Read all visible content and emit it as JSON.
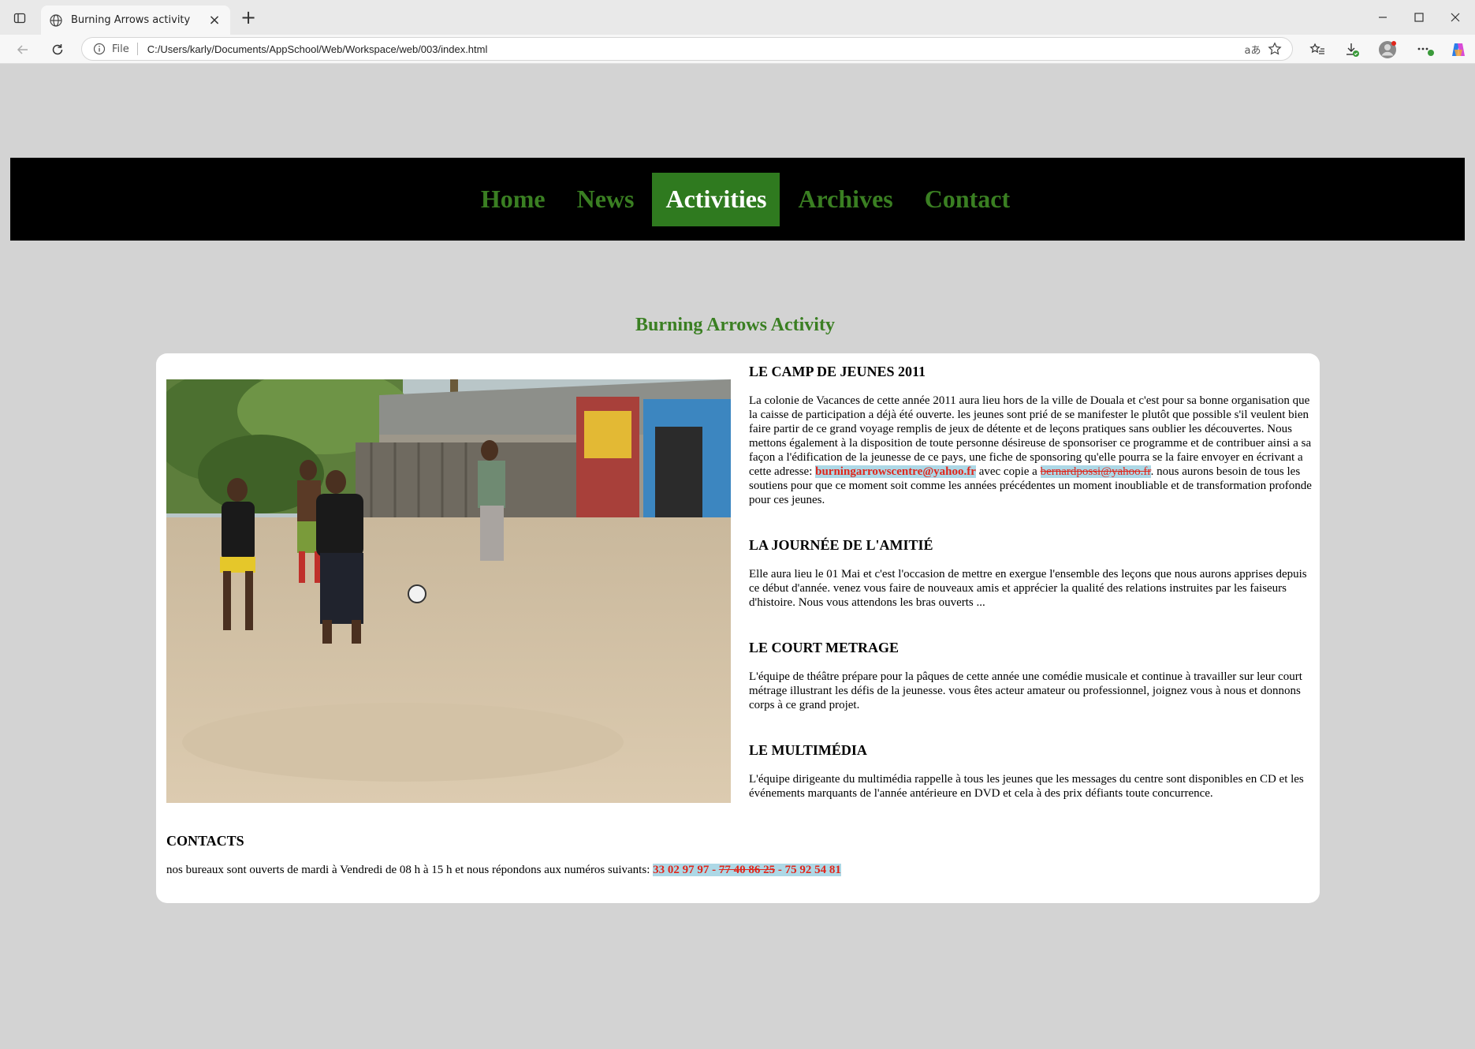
{
  "browser": {
    "tab_title": "Burning Arrows activity",
    "address_protocol": "File",
    "address_url": "C:/Users/karly/Documents/AppSchool/Web/Workspace/web/003/index.html",
    "read_aloud_label": "aあ"
  },
  "nav": {
    "items": [
      {
        "label": "Home",
        "active": false
      },
      {
        "label": "News",
        "active": false
      },
      {
        "label": "Activities",
        "active": true
      },
      {
        "label": "Archives",
        "active": false
      },
      {
        "label": "Contact",
        "active": false
      }
    ]
  },
  "page": {
    "title": "Burning Arrows Activity"
  },
  "sections": [
    {
      "heading": "LE CAMP DE JEUNES 2011",
      "text_before": "La colonie de Vacances de cette année 2011 aura lieu hors de la ville de Douala et c'est pour sa bonne organisation que la caisse de participation a déjà été ouverte. les jeunes sont prié de se manifester le plutôt que possible s'il veulent bien faire partir de ce grand voyage remplis de jeux de détente et de leçons pratiques sans oublier les découvertes. Nous mettons également à la disposition de toute personne désireuse de sponsoriser ce programme et de contribuer ainsi a sa façon a l'édification de la jeunesse de ce pays, une fiche de sponsoring qu'elle pourra se la faire envoyer en écrivant a cette adresse: ",
      "email_1": "burningarrowscentre@yahoo.fr",
      "text_middle": " avec copie a ",
      "email_2": "bernardpossi@yahoo.fr",
      "text_after": ". nous aurons besoin de tous les soutiens pour que ce moment soit comme les années précédentes un moment inoubliable et de transformation profonde pour ces jeunes."
    },
    {
      "heading": "LA JOURNÉE DE L'AMITIÉ",
      "text": "Elle aura lieu le 01 Mai et c'est l'occasion de mettre en exergue l'ensemble des leçons que nous aurons apprises depuis ce début d'année. venez vous faire de nouveaux amis et apprécier la qualité des relations instruites par les faiseurs d'histoire. Nous vous attendons les bras ouverts ..."
    },
    {
      "heading": "LE COURT METRAGE",
      "text": "L'équipe de théâtre prépare pour la pâques de cette année une comédie musicale et continue à travailler sur leur court métrage illustrant les défis de la jeunesse. vous êtes acteur amateur ou professionnel, joignez vous à nous et donnons corps à ce grand projet."
    },
    {
      "heading": "LE MULTIMÉDIA",
      "text": "L'équipe dirigeante du multimédia rappelle à tous les jeunes que les messages du centre sont disponibles en CD et les événements marquants de l'année antérieure en DVD et cela à des prix défiants toute concurrence."
    }
  ],
  "contacts": {
    "heading": "CONTACTS",
    "text": "nos bureaux sont ouverts de mardi à Vendredi de 08 h à 15 h et nous répondons aux numéros suivants: ",
    "phone_1": "33 02 97 97",
    "sep_1": " - ",
    "phone_2": "77 40 86 25",
    "sep_2": " - ",
    "phone_3": "75 92 54 81"
  },
  "colors": {
    "page_background": "#d3d3d3",
    "nav_background": "#000000",
    "accent_green": "#3a7f22",
    "active_green": "#2f7a1f",
    "highlight_bg": "#add8e6",
    "highlight_text": "#e0261b"
  }
}
